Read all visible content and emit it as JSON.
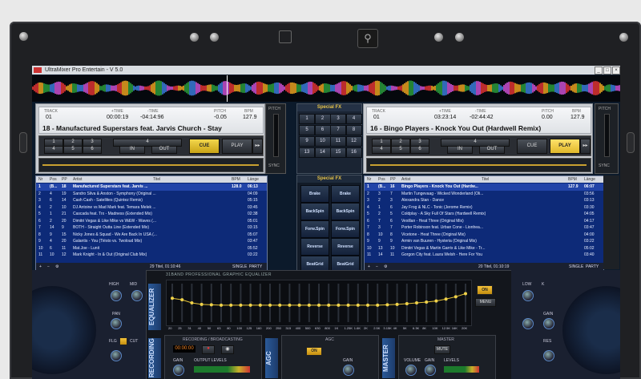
{
  "app": {
    "title": "UltraMixer Pro Entertain - V 5.0"
  },
  "deck_a": {
    "track_label": "TRACK",
    "track": "01",
    "time_label": "+TIME",
    "time": "00:00:19",
    "remain_label": "-TIME",
    "remain": "-04:14:96",
    "pitch_label": "PITCH",
    "pitch": "-0.05",
    "bpm_label": "BPM",
    "bpm": "127.9",
    "title": "18 - Manufactured Superstars feat. Jarvis Church - Stay",
    "cue": "CUE",
    "play": "PLAY",
    "sync": "SYNC",
    "in": "IN",
    "out": "OUT",
    "pitch_side": "PITCH"
  },
  "deck_b": {
    "track_label": "TRACK",
    "track": "01",
    "time_label": "+TIME",
    "time": "03:23:14",
    "remain_label": "-TIME",
    "remain": "-02:44:42",
    "pitch_label": "PITCH",
    "pitch": "0.00",
    "bpm_label": "BPM",
    "bpm": "127.9",
    "title": "16 - Bingo Players - Knock You Out (Hardwell Remix)",
    "cue": "CUE",
    "play": "PLAY",
    "sync": "SYNC",
    "in": "IN",
    "out": "OUT",
    "pitch_side": "PITCH"
  },
  "special_fx": {
    "title": "Special FX",
    "pads": [
      "1",
      "2",
      "3",
      "4",
      "5",
      "6",
      "7",
      "8",
      "9",
      "10",
      "11",
      "12",
      "13",
      "14",
      "15",
      "16"
    ],
    "panel_title": "Special FX",
    "buttons": [
      "Brake",
      "Brake",
      "BackSpin",
      "BackSpin",
      "Forw.Spin",
      "Forw.Spin",
      "Reverse",
      "Reverse",
      "BeatGrid",
      "BeatGrid"
    ]
  },
  "playlist_a": {
    "headers": [
      "Nr",
      "Pos",
      "PP",
      "Artist",
      "Titel",
      "BPM",
      "Länge"
    ],
    "rows": [
      [
        "1",
        "(B...",
        "18",
        "Manufactured Superstars feat. Jarvis ...",
        "128.0",
        "06:13"
      ],
      [
        "2",
        "4",
        "19",
        "Sandro Silva & Anston - Symphony (Original ...",
        "",
        "04:09"
      ],
      [
        "3",
        "6",
        "14",
        "Cash Cash - Satellites (Quintez Remix)",
        "",
        "05:15"
      ],
      [
        "4",
        "2",
        "10",
        "DJ Antoine vs Mad Mark feat. Temara Melek ...",
        "",
        "03:45"
      ],
      [
        "5",
        "1",
        "21",
        "Cascada feat. Trx - Madness (Extended Mix)",
        "",
        "02:38"
      ],
      [
        "6",
        "2",
        "20",
        "Dimitri Vegas & Like Mike vs W&W - Waves (...",
        "",
        "05:01"
      ],
      [
        "7",
        "14",
        "9",
        "BOTH - Straight Outta Line (Extended Mix)",
        "",
        "03:15"
      ],
      [
        "8",
        "9",
        "15",
        "Nicky Jones & Squad - We Are Back In USA (...",
        "",
        "05:07"
      ],
      [
        "9",
        "4",
        "20",
        "Galantis - You (Tiësto vs. Twoloud Mix)",
        "",
        "03:47"
      ],
      [
        "10",
        "6",
        "11",
        "Mat.Joe - Lunit",
        "",
        "05:52"
      ],
      [
        "11",
        "10",
        "12",
        "Mark Knight - In & Out (Original Club Mix)",
        "",
        "03:22"
      ]
    ],
    "footer_count": "29 Titel, 01:10:46",
    "single": "SINGLE",
    "party": "PARTY"
  },
  "playlist_b": {
    "headers": [
      "Nr",
      "Pos",
      "PP",
      "Artist",
      "Titel",
      "BPM",
      "Länge"
    ],
    "rows": [
      [
        "1",
        "(B...",
        "16",
        "Bingo Players - Knock You Out (Hardw...",
        "127.9",
        "06:07"
      ],
      [
        "2",
        "3",
        "7",
        "Martin Tungevaag - Wicked Wonderland (Oli...",
        "",
        "03:56"
      ],
      [
        "3",
        "2",
        "3",
        "Alexandra Stan - Dance",
        "",
        "03:13"
      ],
      [
        "4",
        "1",
        "6",
        "Jay Frog & NLC - Tonic (Jerome Remix)",
        "",
        "03:30"
      ],
      [
        "5",
        "2",
        "5",
        "Coldplay - A Sky Full Of Stars (Hardwell Remix)",
        "",
        "04:05"
      ],
      [
        "6",
        "7",
        "6",
        "Vexillan - Heat Three (Original Mix)",
        "",
        "04:17"
      ],
      [
        "7",
        "3",
        "7",
        "Porter Robinson feat. Urban Cone - Lionhea...",
        "",
        "03:47"
      ],
      [
        "8",
        "10",
        "8",
        "Vicetone - Heat Three (Original Mix)",
        "",
        "04:00"
      ],
      [
        "9",
        "9",
        "9",
        "Armin van Buuren - Hysteria (Original Mix)",
        "",
        "03:22"
      ],
      [
        "10",
        "13",
        "10",
        "Dimitri Vegas & Martin Garrix & Like Mike - Tr...",
        "",
        "05:02"
      ],
      [
        "11",
        "14",
        "11",
        "Gorgon City feat. Laura Welsh - Here For You",
        "",
        "03:40"
      ]
    ],
    "footer_count": "20 Titel, 01:10:19",
    "single": "SINGLE",
    "party": "PARTY"
  },
  "equalizer": {
    "tab": "EQUALIZER",
    "title": "31BAND PROFESSIONAL GRAPHIC EQUALIZER",
    "bands": [
      "20",
      "25",
      "31",
      "40",
      "50",
      "63",
      "80",
      "100",
      "125",
      "160",
      "200",
      "250",
      "315",
      "400",
      "500",
      "630",
      "800",
      "1K",
      "1.25K",
      "1.6K",
      "2K",
      "2.5K",
      "3.15K",
      "4K",
      "5K",
      "6.3K",
      "8K",
      "10K",
      "12.5K",
      "16K",
      "20K"
    ],
    "levels": [
      0.62,
      0.58,
      0.5,
      0.46,
      0.45,
      0.44,
      0.44,
      0.44,
      0.44,
      0.44,
      0.44,
      0.44,
      0.44,
      0.44,
      0.44,
      0.44,
      0.44,
      0.44,
      0.44,
      0.44,
      0.44,
      0.44,
      0.45,
      0.46,
      0.48,
      0.5,
      0.52,
      0.55,
      0.6,
      0.66,
      0.74
    ],
    "on": "ON",
    "menu": "MENU"
  },
  "recording": {
    "tab": "RECORDING",
    "title": "RECORDING / BROADCASTING",
    "time": "00:00:00",
    "gain": "GAIN",
    "output_levels": "OUTPUT LEVELS"
  },
  "agc": {
    "tab": "AGC",
    "title": "AGC",
    "on": "ON",
    "gain": "GAIN"
  },
  "master": {
    "tab": "MASTER",
    "title": "MASTER",
    "mute": "MUTE",
    "volume": "VOLUME",
    "gain": "GAIN",
    "levels": "LEVELS"
  },
  "mixer_left": {
    "high": "HIGH",
    "k": "K",
    "mid": "MID",
    "pan": "PAN",
    "flg": "FLG",
    "cut": "CUT"
  },
  "mixer_right": {
    "low": "LOW",
    "k": "K",
    "gain": "GAIN",
    "res": "RES"
  }
}
